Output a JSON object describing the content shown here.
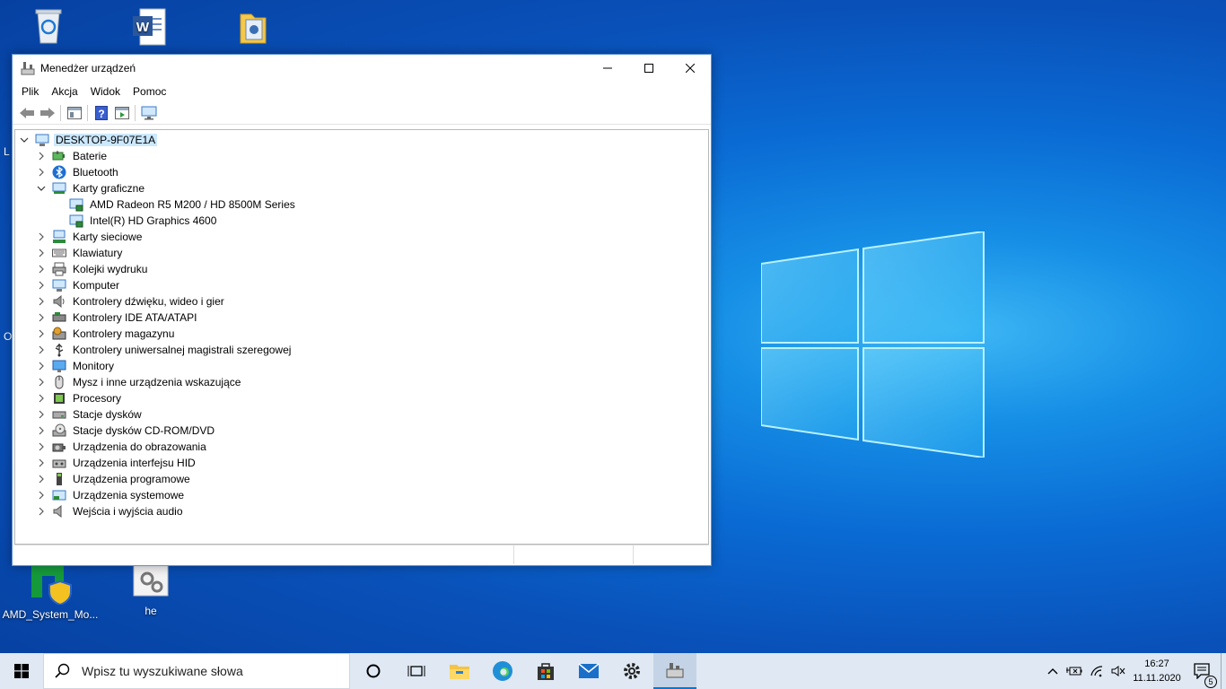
{
  "desktop": {
    "icons": [
      {
        "name": "recycle-bin",
        "label": ""
      },
      {
        "name": "word-doc",
        "label": ""
      },
      {
        "name": "folder-doc",
        "label": ""
      },
      {
        "name": "amd-system-monitor",
        "label": "AMD_System_Mo..."
      },
      {
        "name": "he-settings",
        "label": "he"
      }
    ],
    "edge_letters": [
      "L",
      "O"
    ]
  },
  "window": {
    "title": "Menedżer urządzeń",
    "menu": [
      "Plik",
      "Akcja",
      "Widok",
      "Pomoc"
    ],
    "tree": {
      "root": "DESKTOP-9F07E1A",
      "categories": [
        {
          "label": "Baterie",
          "icon": "battery-icon",
          "expanded": false
        },
        {
          "label": "Bluetooth",
          "icon": "bluetooth-icon",
          "expanded": false
        },
        {
          "label": "Karty graficzne",
          "icon": "display-adapter-icon",
          "expanded": true,
          "children": [
            "AMD Radeon R5 M200 / HD 8500M Series",
            "Intel(R) HD Graphics 4600"
          ]
        },
        {
          "label": "Karty sieciowe",
          "icon": "network-adapter-icon",
          "expanded": false
        },
        {
          "label": "Klawiatury",
          "icon": "keyboard-icon",
          "expanded": false
        },
        {
          "label": "Kolejki wydruku",
          "icon": "printer-icon",
          "expanded": false
        },
        {
          "label": "Komputer",
          "icon": "computer-icon",
          "expanded": false
        },
        {
          "label": "Kontrolery dźwięku, wideo i gier",
          "icon": "speaker-icon",
          "expanded": false
        },
        {
          "label": "Kontrolery IDE ATA/ATAPI",
          "icon": "ide-controller-icon",
          "expanded": false
        },
        {
          "label": "Kontrolery magazynu",
          "icon": "storage-controller-icon",
          "expanded": false
        },
        {
          "label": "Kontrolery uniwersalnej magistrali szeregowej",
          "icon": "usb-icon",
          "expanded": false
        },
        {
          "label": "Monitory",
          "icon": "monitor-icon",
          "expanded": false
        },
        {
          "label": "Mysz i inne urządzenia wskazujące",
          "icon": "mouse-icon",
          "expanded": false
        },
        {
          "label": "Procesory",
          "icon": "processor-icon",
          "expanded": false
        },
        {
          "label": "Stacje dysków",
          "icon": "disk-drive-icon",
          "expanded": false
        },
        {
          "label": "Stacje dysków CD-ROM/DVD",
          "icon": "cdrom-icon",
          "expanded": false
        },
        {
          "label": "Urządzenia do obrazowania",
          "icon": "camera-icon",
          "expanded": false
        },
        {
          "label": "Urządzenia interfejsu HID",
          "icon": "hid-icon",
          "expanded": false
        },
        {
          "label": "Urządzenia programowe",
          "icon": "software-device-icon",
          "expanded": false
        },
        {
          "label": "Urządzenia systemowe",
          "icon": "system-device-icon",
          "expanded": false
        },
        {
          "label": "Wejścia i wyjścia audio",
          "icon": "audio-io-icon",
          "expanded": false
        }
      ]
    }
  },
  "taskbar": {
    "search_placeholder": "Wpisz tu wyszukiwane słowa",
    "time": "16:27",
    "date": "11.11.2020",
    "notification_count": "5"
  },
  "colors": {
    "selection": "#cce8ff",
    "taskbar": "#dfe8f3",
    "accent": "#0078d7"
  }
}
